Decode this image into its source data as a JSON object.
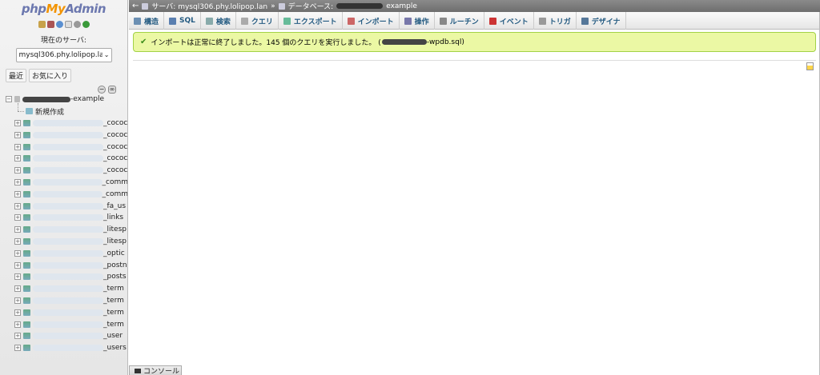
{
  "logo": {
    "php": "php",
    "my": "My",
    "admin": "Admin"
  },
  "nav": {
    "server_label": "現在のサーバ:",
    "server_value": "mysql306.phy.lolipop.lan",
    "tabs": [
      "最近",
      "お気に入り"
    ],
    "db_suffix": "-example",
    "new_item": "新規作成",
    "tables": [
      "_cococ",
      "_cococ",
      "_cococ",
      "_cococ",
      "_cococ",
      "_comm",
      "_comm",
      "_fa_us",
      "_links",
      "_litesp",
      "_litesp",
      "_optic",
      "_postn",
      "_posts",
      "_term",
      "_term",
      "_term",
      "_term",
      "_user",
      "_users"
    ]
  },
  "breadcrumb": {
    "back": "←",
    "server": "サーバ: mysql306.phy.lolipop.lan",
    "sep": "»",
    "db_prefix": "データベース:",
    "db_suffix": "example"
  },
  "tabs": [
    {
      "label": "構造",
      "icon": "structure-icon",
      "color": "#6b8fb3"
    },
    {
      "label": "SQL",
      "icon": "sql-icon",
      "color": "#5a7fb0"
    },
    {
      "label": "検索",
      "icon": "search-icon",
      "color": "#8aa"
    },
    {
      "label": "クエリ",
      "icon": "query-icon",
      "color": "#aaa"
    },
    {
      "label": "エクスポート",
      "icon": "export-icon",
      "color": "#6b9"
    },
    {
      "label": "インポート",
      "icon": "import-icon",
      "color": "#c66"
    },
    {
      "label": "操作",
      "icon": "operations-icon",
      "color": "#77a"
    },
    {
      "label": "ルーチン",
      "icon": "routines-icon",
      "color": "#888"
    },
    {
      "label": "イベント",
      "icon": "events-icon",
      "color": "#c33"
    },
    {
      "label": "トリガ",
      "icon": "triggers-icon",
      "color": "#999"
    },
    {
      "label": "デザイナ",
      "icon": "designer-icon",
      "color": "#579"
    }
  ],
  "success": {
    "message": "インポートは正常に終了しました。145 個のクエリを実行しました。 (",
    "file_suffix": "-wpdb.sql)"
  },
  "console": {
    "label": "コンソール"
  }
}
